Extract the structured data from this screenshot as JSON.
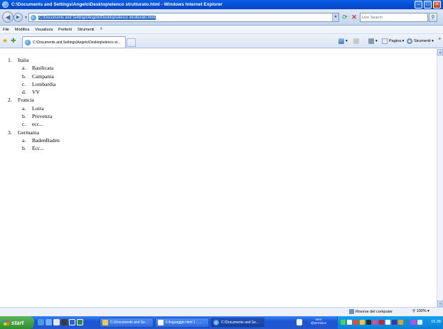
{
  "window": {
    "title": "C:\\Documents and Settings\\Angelo\\Desktop\\elenco strutturato.html - Windows Internet Explorer"
  },
  "address_bar": {
    "url": "C:\\Documents and Settings\\Angelo\\Desktop\\elenco strutturato.html"
  },
  "search": {
    "placeholder": "Live Search"
  },
  "menu": [
    "File",
    "Modifica",
    "Visualizza",
    "Preferiti",
    "Strumenti",
    "?"
  ],
  "tab": {
    "label": "C:\\Documents and Settings\\Angelo\\Desktop\\elenco st..."
  },
  "command_bar": {
    "page_label": "Pagina",
    "tools_label": "Strumenti",
    "more": "»"
  },
  "content": {
    "list": [
      {
        "num": "1.",
        "label": "Italia",
        "items": [
          {
            "num": "a.",
            "label": "Basilicata"
          },
          {
            "num": "b.",
            "label": "Campania"
          },
          {
            "num": "c.",
            "label": "Lombardia"
          },
          {
            "num": "d.",
            "label": "VV"
          }
        ]
      },
      {
        "num": "2.",
        "label": "Francia",
        "items": [
          {
            "num": "a.",
            "label": "Loira"
          },
          {
            "num": "b.",
            "label": "Provenza"
          },
          {
            "num": "c.",
            "label": "ecc..."
          }
        ]
      },
      {
        "num": "3.",
        "label": "Germania",
        "items": [
          {
            "num": "a.",
            "label": "BadenBaden"
          },
          {
            "num": "b.",
            "label": "Ecc..."
          }
        ]
      }
    ]
  },
  "status_bar": {
    "zone": "Risorse del computer",
    "zoom": "100%"
  },
  "taskbar": {
    "start_label": "start",
    "tasks": [
      {
        "label": "C:\\Documents and Se..."
      },
      {
        "label": "Il linguaggio html 1 - ..."
      },
      {
        "label": "C:\\Documents and Se..."
      }
    ],
    "nero_label": "nero",
    "nero_sub": "@terminus",
    "clock": "15.36"
  },
  "colors": {
    "title_bar": "#0a5ee6",
    "taskbar": "#2357d0",
    "start_button": "#3e9f3e",
    "tray": "#13a0ec",
    "url_selection": "#316ac5"
  }
}
